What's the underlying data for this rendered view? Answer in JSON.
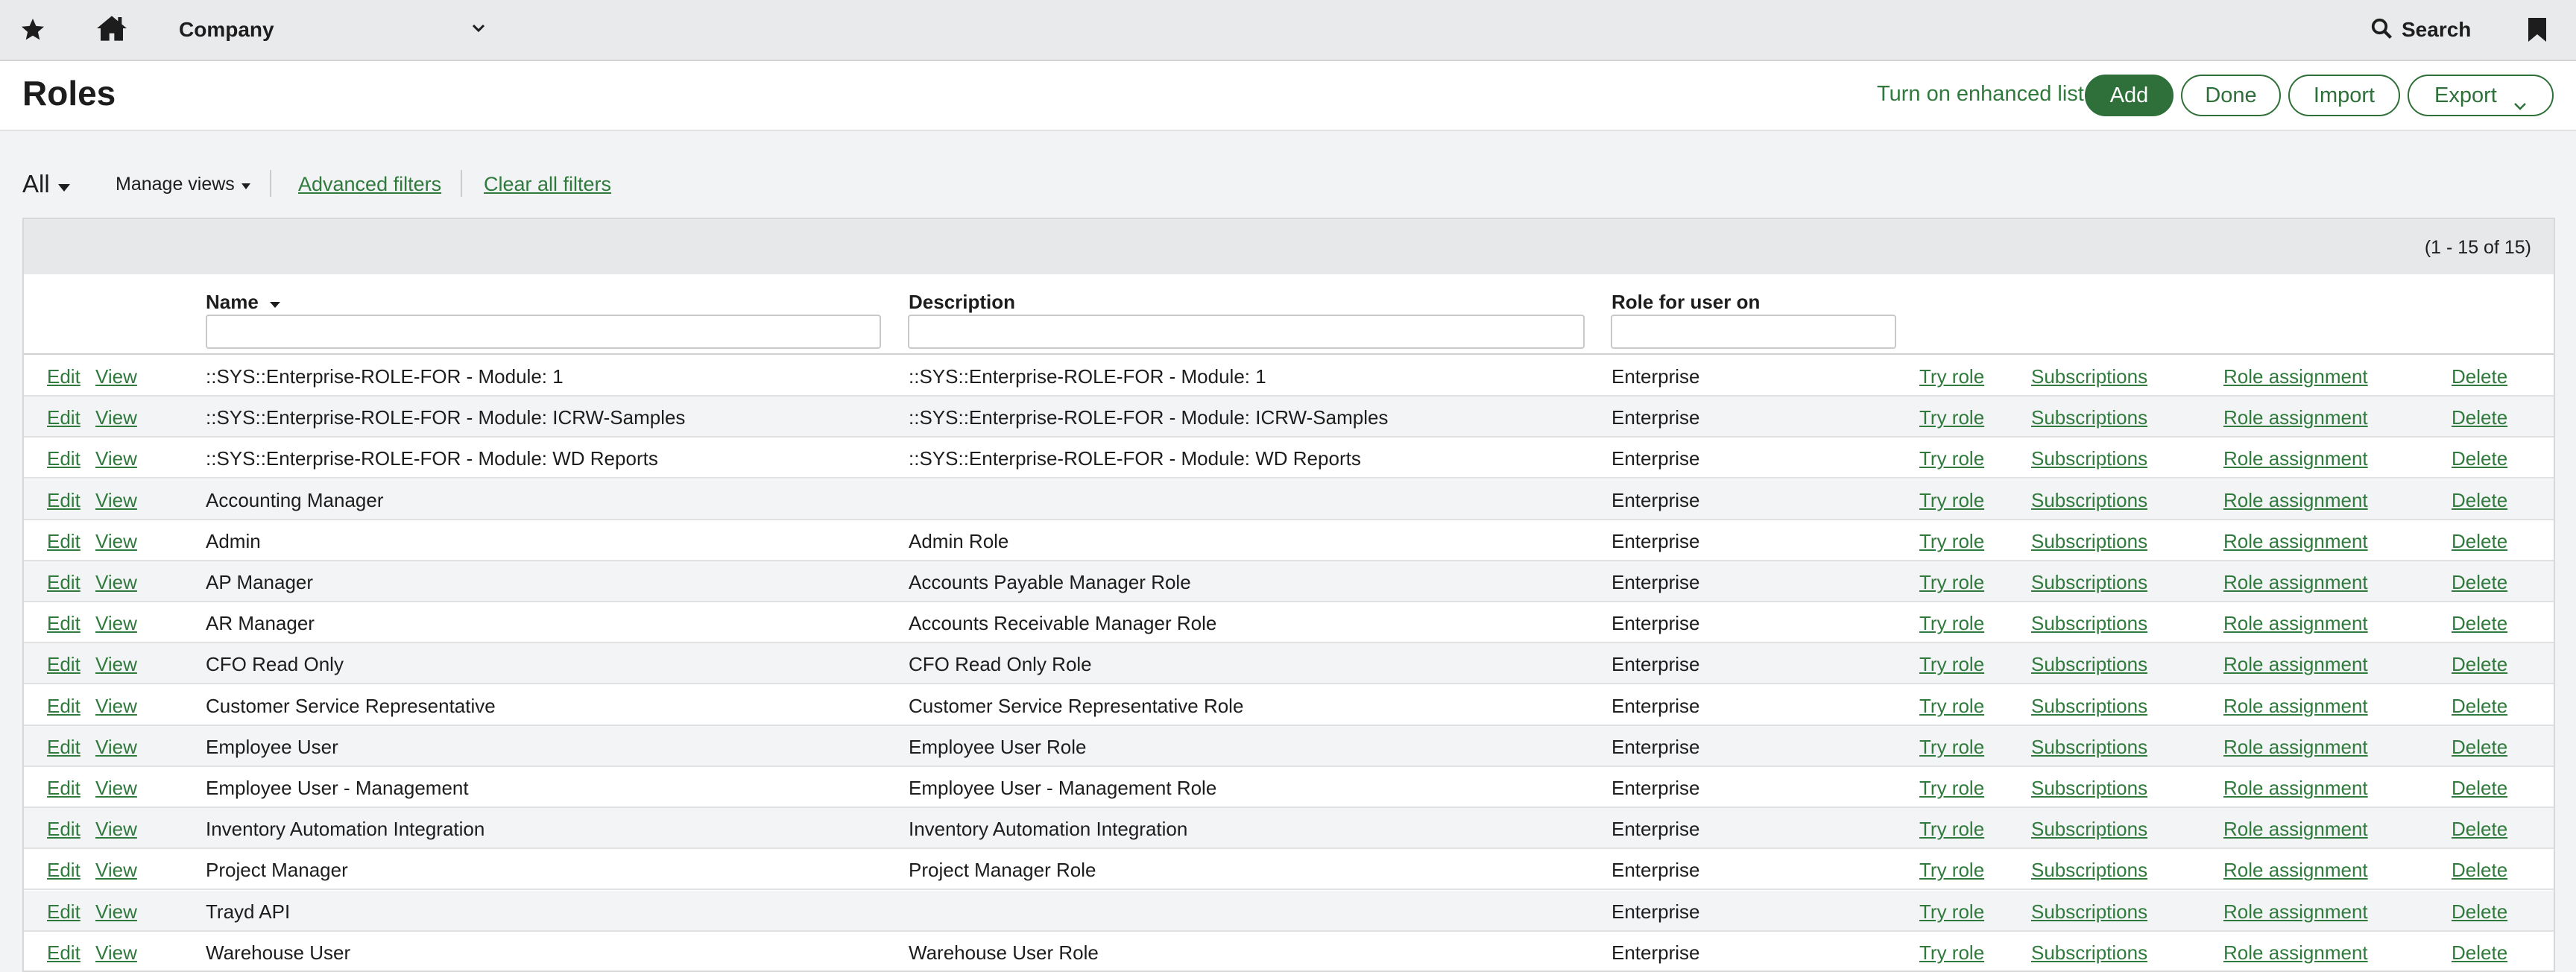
{
  "topbar": {
    "company": "Company",
    "search_label": "Search"
  },
  "title": "Roles",
  "actions": {
    "enhanced_list": "Turn on enhanced list",
    "add": "Add",
    "done": "Done",
    "import": "Import",
    "export": "Export"
  },
  "filters": {
    "view": "All",
    "manage_views": "Manage views",
    "advanced": "Advanced filters",
    "clear_all": "Clear all filters"
  },
  "grid": {
    "count": "(1 - 15 of 15)",
    "columns": {
      "name": "Name",
      "description": "Description",
      "role_for": "Role for user on"
    },
    "row_links": {
      "edit": "Edit",
      "view": "View",
      "try_role": "Try role",
      "subscriptions": "Subscriptions",
      "role_assignment": "Role assignment",
      "delete": "Delete"
    },
    "rows": [
      {
        "name": "::SYS::Enterprise-ROLE-FOR - Module: 1",
        "description": "::SYS::Enterprise-ROLE-FOR - Module: 1",
        "role_for": "Enterprise"
      },
      {
        "name": "::SYS::Enterprise-ROLE-FOR - Module: ICRW-Samples",
        "description": "::SYS::Enterprise-ROLE-FOR - Module: ICRW-Samples",
        "role_for": "Enterprise"
      },
      {
        "name": "::SYS::Enterprise-ROLE-FOR - Module: WD Reports",
        "description": "::SYS::Enterprise-ROLE-FOR - Module: WD Reports",
        "role_for": "Enterprise"
      },
      {
        "name": "Accounting Manager",
        "description": "",
        "role_for": "Enterprise"
      },
      {
        "name": "Admin",
        "description": "Admin Role",
        "role_for": "Enterprise"
      },
      {
        "name": "AP Manager",
        "description": "Accounts Payable Manager Role",
        "role_for": "Enterprise"
      },
      {
        "name": "AR Manager",
        "description": "Accounts Receivable Manager Role",
        "role_for": "Enterprise"
      },
      {
        "name": "CFO Read Only",
        "description": "CFO Read Only Role",
        "role_for": "Enterprise"
      },
      {
        "name": "Customer Service Representative",
        "description": "Customer Service Representative Role",
        "role_for": "Enterprise"
      },
      {
        "name": "Employee User",
        "description": "Employee User Role",
        "role_for": "Enterprise"
      },
      {
        "name": "Employee User - Management",
        "description": "Employee User - Management Role",
        "role_for": "Enterprise"
      },
      {
        "name": "Inventory Automation Integration",
        "description": "Inventory Automation Integration",
        "role_for": "Enterprise"
      },
      {
        "name": "Project Manager",
        "description": "Project Manager Role",
        "role_for": "Enterprise"
      },
      {
        "name": "Trayd API",
        "description": "",
        "role_for": "Enterprise"
      },
      {
        "name": "Warehouse User",
        "description": "Warehouse User Role",
        "role_for": "Enterprise"
      }
    ]
  },
  "colors": {
    "accent_green": "#2f6f3a",
    "link_green": "#2f7a3c"
  }
}
